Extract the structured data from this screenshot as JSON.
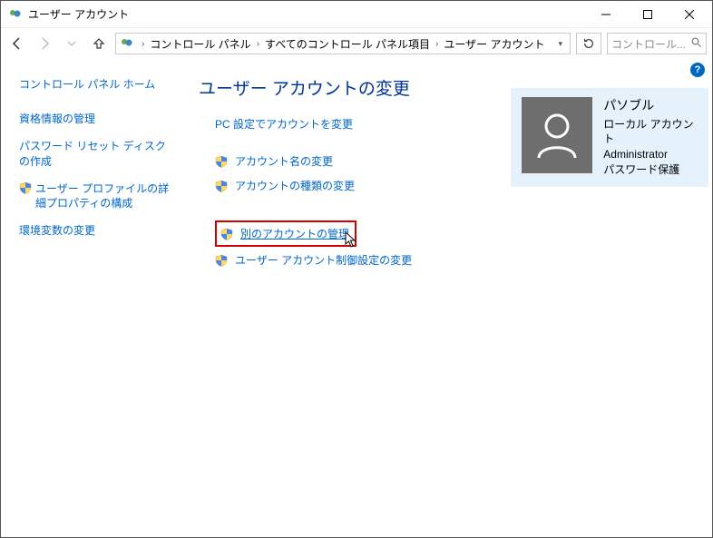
{
  "window": {
    "title": "ユーザー アカウント"
  },
  "breadcrumb": {
    "items": [
      "コントロール パネル",
      "すべてのコントロール パネル項目",
      "ユーザー アカウント"
    ]
  },
  "search": {
    "placeholder": "コントロール..."
  },
  "sidebar": {
    "home": "コントロール パネル ホーム",
    "items": [
      {
        "label": "資格情報の管理",
        "shield": false
      },
      {
        "label": "パスワード リセット ディスクの作成",
        "shield": false
      },
      {
        "label": "ユーザー プロファイルの詳細プロパティの構成",
        "shield": true
      },
      {
        "label": "環境変数の変更",
        "shield": false
      }
    ]
  },
  "main": {
    "heading": "ユーザー アカウントの変更",
    "tasks_group1": [
      {
        "label": "PC 設定でアカウントを変更",
        "shield": false
      },
      {
        "label": "アカウント名の変更",
        "shield": true
      },
      {
        "label": "アカウントの種類の変更",
        "shield": true
      }
    ],
    "tasks_group2": [
      {
        "label": "別のアカウントの管理",
        "shield": true,
        "highlighted": true
      },
      {
        "label": "ユーザー アカウント制御設定の変更",
        "shield": true,
        "highlighted": false
      }
    ]
  },
  "profile": {
    "name": "パソブル",
    "type": "ローカル アカウント",
    "role": "Administrator",
    "protection": "パスワード保護"
  }
}
